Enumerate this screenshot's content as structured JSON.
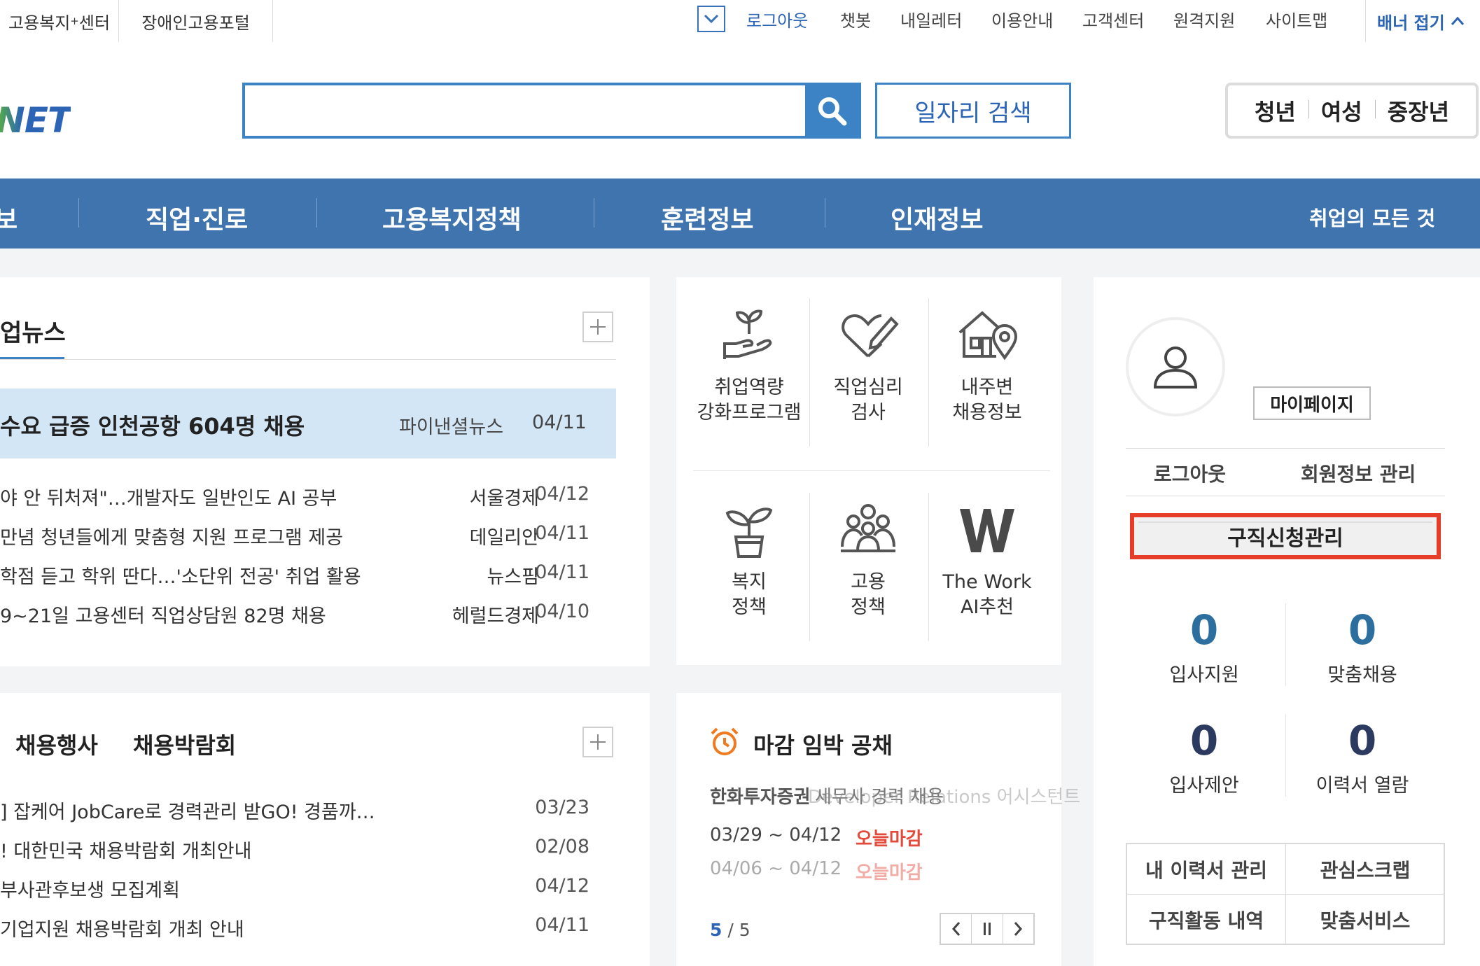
{
  "topbar": {
    "left_links": [
      {
        "label": "고용복지",
        "sup": "+",
        "suffix": "센터"
      },
      {
        "label": "장애인고용포털"
      }
    ],
    "nav": [
      "로그아웃",
      "챗봇",
      "내일레터",
      "이용안내",
      "고객센터",
      "원격지원",
      "사이트맵"
    ],
    "banner_toggle": "배너 접기"
  },
  "header": {
    "logo_text": "NET",
    "search": {
      "value": "",
      "placeholder": ""
    },
    "job_search_button": "일자리 검색",
    "target_groups": [
      "청년",
      "여성",
      "중장년"
    ]
  },
  "main_nav": {
    "items": [
      "보",
      "직업·진로",
      "고용복지정책",
      "훈련정보",
      "인재정보"
    ],
    "right_label": "취업의 모든 것"
  },
  "news": {
    "tab": "업뉴스",
    "highlight": {
      "title": "수요 급증 인천공항 604명 채용",
      "source": "파이낸셜뉴스",
      "date": "04/11"
    },
    "items": [
      {
        "title": "야 안 뒤처져\"…개발자도 일반인도 AI 공부",
        "source": "서울경제",
        "date": "04/12"
      },
      {
        "title": "만념 청년들에게 맞춤형 지원 프로그램 제공",
        "source": "데일리안",
        "date": "04/11"
      },
      {
        "title": "학점 듣고 학위 딴다…'소단위 전공' 취업 활용",
        "source": "뉴스핌",
        "date": "04/11"
      },
      {
        "title": "9~21일 고용센터 직업상담원 82명 채용",
        "source": "헤럴드경제",
        "date": "04/10"
      }
    ]
  },
  "events": {
    "tabs": [
      "채용행사",
      "채용박람회"
    ],
    "items": [
      {
        "title": "] 잡케어 JobCare로 경력관리 받GO! 경품까…",
        "date": "03/23"
      },
      {
        "title": "! 대한민국 채용박람회 개최안내",
        "date": "02/08"
      },
      {
        "title": "부사관후보생 모집계획",
        "date": "04/12"
      },
      {
        "title": "기업지원 채용박람회 개최 안내",
        "date": "04/11"
      }
    ]
  },
  "services": [
    {
      "icon": "sprout-hand-icon",
      "line1": "취업역량",
      "line2": "강화프로그램"
    },
    {
      "icon": "heart-pencil-icon",
      "line1": "직업심리",
      "line2": "검사"
    },
    {
      "icon": "house-pin-icon",
      "line1": "내주변",
      "line2": "채용정보"
    },
    {
      "icon": "potted-plant-icon",
      "line1": "복지",
      "line2": "정책"
    },
    {
      "icon": "people-group-icon",
      "line1": "고용",
      "line2": "정책"
    },
    {
      "icon": "w-logo-icon",
      "line1": "The Work",
      "line2": "AI추천"
    }
  ],
  "deadline": {
    "title": "마감 임박 공채",
    "items": [
      {
        "company": "한화투자증권",
        "position": "세무사 경력 채용",
        "period": "03/29 ~ 04/12",
        "badge": "오늘마감"
      },
      {
        "company": "",
        "position": "Developer Relations 어시스턴트",
        "period": "04/06 ~ 04/12",
        "badge": "오늘마감"
      }
    ],
    "page_current": "5",
    "page_total": "/ 5"
  },
  "mypage": {
    "button": "마이페이지",
    "logout": "로그아웃",
    "member_info": "회원정보 관리",
    "apply_manage": "구직신청관리",
    "stats": [
      {
        "value": "0",
        "label": "입사지원",
        "color": "#2c6f9e"
      },
      {
        "value": "0",
        "label": "맞춤채용",
        "color": "#2c6f9e"
      },
      {
        "value": "0",
        "label": "입사제안",
        "color": "#2b3a5e"
      },
      {
        "value": "0",
        "label": "이력서 열람",
        "color": "#2b3a5e"
      }
    ],
    "grid": [
      "내 이력서 관리",
      "관심스크랩",
      "구직활동 내역",
      "맞춤서비스"
    ]
  },
  "colors": {
    "accent": "#3b83c4",
    "nav_bg": "#3f74ae",
    "highlight_red": "#e53d27",
    "logo_blue": "#2c64b6",
    "logo_green": "#5bb33f"
  }
}
